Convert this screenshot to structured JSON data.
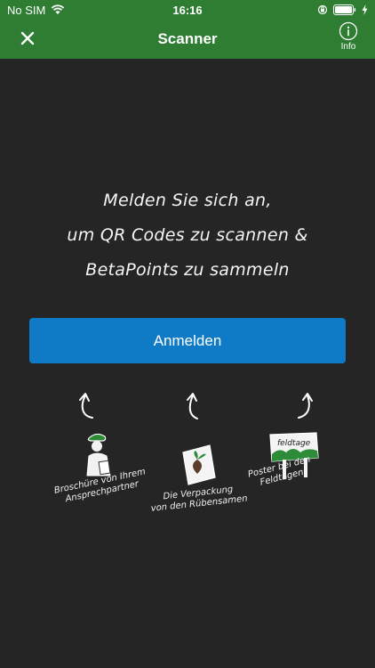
{
  "status_bar": {
    "carrier": "No SIM",
    "time": "16:16"
  },
  "nav": {
    "title": "Scanner",
    "info_label": "Info"
  },
  "main": {
    "headline_lines": [
      "Melden Sie sich an,",
      "um QR Codes zu scannen &",
      "BetaPoints zu sammeln"
    ],
    "login_button": "Anmelden",
    "sources": [
      {
        "caption_lines": [
          "Broschüre von Ihrem",
          "Ansprechpartner"
        ]
      },
      {
        "caption_lines": [
          "Die Verpackung",
          "von den Rübensamen"
        ]
      },
      {
        "caption_lines": [
          "Poster bei den",
          "Feldtagen"
        ]
      }
    ],
    "poster_sign": "feldtage"
  },
  "colors": {
    "header_green": "#2e7d32",
    "background": "#252525",
    "button_blue": "#0f7bc6"
  }
}
